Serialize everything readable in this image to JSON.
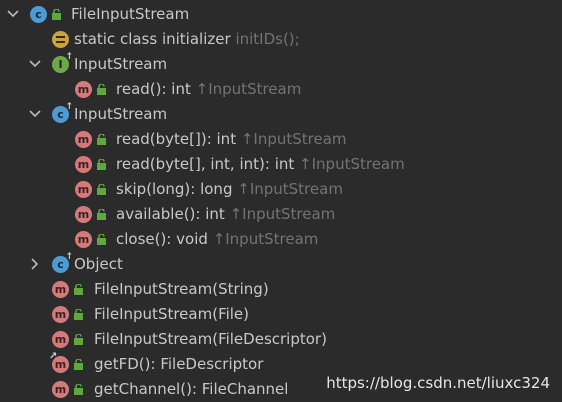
{
  "tree": {
    "root": {
      "name": "FileInputStream",
      "icon": "class-icon"
    },
    "initializer": {
      "name": "static class initializer",
      "hint": "initIDs();"
    },
    "interface_group": {
      "name": "InputStream",
      "icon": "interface-icon",
      "items": [
        {
          "signature": "read(): int",
          "hint": "↑InputStream"
        }
      ]
    },
    "class_group": {
      "name": "InputStream",
      "icon": "abstract-class-icon",
      "items": [
        {
          "signature": "read(byte[]): int",
          "hint": "↑InputStream"
        },
        {
          "signature": "read(byte[], int, int): int",
          "hint": "↑InputStream"
        },
        {
          "signature": "skip(long): long",
          "hint": "↑InputStream"
        },
        {
          "signature": "available(): int",
          "hint": "↑InputStream"
        },
        {
          "signature": "close(): void",
          "hint": "↑InputStream"
        }
      ]
    },
    "object_group": {
      "name": "Object"
    },
    "members": [
      {
        "signature": "FileInputStream(String)"
      },
      {
        "signature": "FileInputStream(File)"
      },
      {
        "signature": "FileInputStream(FileDescriptor)"
      },
      {
        "signature": "getFD(): FileDescriptor"
      },
      {
        "signature": "getChannel(): FileChannel"
      }
    ],
    "icon_letters": {
      "method": "m",
      "class": "c",
      "interface": "I",
      "abstract": "c"
    }
  },
  "watermark": "https://blog.csdn.net/liuxc324",
  "colors": {
    "background": "#2b2b2b",
    "method": "#d6797b",
    "class": "#4c9bd4",
    "interface": "#6fa84a",
    "initializer": "#c9a342",
    "hint": "#737373"
  }
}
